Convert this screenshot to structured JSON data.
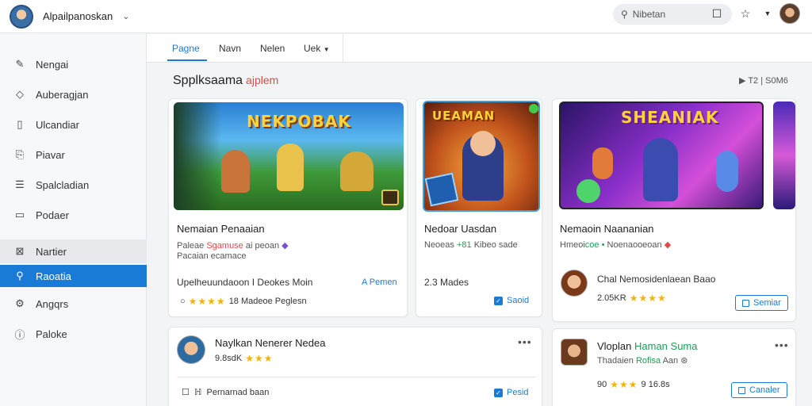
{
  "brand": {
    "name": "Alpailpanoskan",
    "chevron": "chevron-down-icon"
  },
  "sidebar": {
    "items": [
      {
        "label": "Nengai",
        "icon": "edit-icon"
      },
      {
        "label": "Auberagjan",
        "icon": "diamond-icon"
      },
      {
        "label": "Ulcandiar",
        "icon": "book-icon"
      },
      {
        "label": "Piavar",
        "icon": "document-icon"
      },
      {
        "label": "Spalcladian",
        "icon": "list-icon"
      },
      {
        "label": "Podaer",
        "icon": "file-icon"
      },
      {
        "label": "Nartier",
        "icon": "image-icon"
      },
      {
        "label": "Raoatia",
        "icon": "user-icon"
      },
      {
        "label": "Angqrs",
        "icon": "gear-icon"
      },
      {
        "label": "Paloke",
        "icon": "info-icon"
      }
    ],
    "active_index": 7,
    "hover_index": 6
  },
  "topbar": {
    "search_text": "Nibetan",
    "icons": [
      "square-icon",
      "star-icon",
      "chevron-down-icon"
    ]
  },
  "tabs": {
    "items": [
      "Pagne",
      "Navn",
      "Nelen",
      "Uek"
    ],
    "active_index": 0
  },
  "section": {
    "title": "Spplksaama",
    "accent": "ajplem",
    "meta": "T2 | S0M6"
  },
  "cards": [
    {
      "art_title": "NEKPOBAK",
      "title": "Nemaian Penaaian",
      "sub_plain": "Paleae",
      "sub_accent": "Sgamuse",
      "sub_tail": "ai peoan",
      "sub2": "Pacaian  ecamace",
      "line": "Upelheuundaoon  I Deokes  Moin",
      "action": "A Pemen",
      "rating_num": "18",
      "rating_text": "Madeoe  Peglesn"
    },
    {
      "art_title": "UEAMAN",
      "title": "Nedoar Uasdan",
      "sub_plain": "Neoeas",
      "sub_accent": "+81",
      "sub_tail": "Kibeo sade",
      "line": "2.3  Mades",
      "action": "Saoid"
    },
    {
      "art_title": "SHEANIAK",
      "title": "Nemaoin Naananian",
      "sub_plain": "Hmeoi",
      "sub_accent": "coe",
      "sub_tail": "Noenaooeoan",
      "line": "Chal Nemosidenlaean Baao",
      "rating_num": "2.05KR",
      "action": "Semiar"
    }
  ],
  "lower_cards": [
    {
      "title": "Naylkan Nenerer Nedea",
      "rating_num": "9.8sdK",
      "line": "Pernarnad  baan",
      "action": "Pesid"
    },
    {
      "title_plain": "Vloplan",
      "title_accent": "Haman Suma",
      "sub_plain": "Thadaien",
      "sub_accent": "Rofisa",
      "sub_tail": "Aan",
      "rating_num": "90",
      "rating_tail": "9 16.8s",
      "action": "Canaler"
    }
  ],
  "colors": {
    "accent": "#1a7bd6",
    "star": "#f5b301",
    "highlight_red": "#e04a4a",
    "highlight_green": "#1f9d55"
  }
}
